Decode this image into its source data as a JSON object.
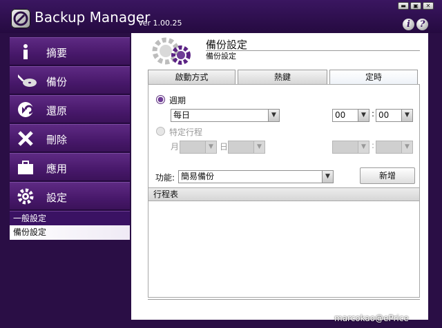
{
  "app": {
    "title": "Backup Manager",
    "version": "Ver 1.00.25",
    "window_buttons": {
      "minimize": "▬",
      "maximize": "▣",
      "close": "✕"
    },
    "info_icon_glyph": "i",
    "help_icon_glyph": "?"
  },
  "sidebar": {
    "items": [
      {
        "label": "摘要",
        "icon": "info-icon"
      },
      {
        "label": "備份",
        "icon": "backup-disc-icon"
      },
      {
        "label": "還原",
        "icon": "restore-icon"
      },
      {
        "label": "刪除",
        "icon": "delete-x-icon"
      },
      {
        "label": "應用",
        "icon": "briefcase-icon"
      },
      {
        "label": "設定",
        "icon": "gear-icon"
      }
    ],
    "sub_items": [
      {
        "label": "一般設定"
      },
      {
        "label": "備份設定",
        "selected": true
      }
    ]
  },
  "main": {
    "title": "備份設定",
    "subtitle": "備份設定",
    "tabs": [
      {
        "label": "啟動方式"
      },
      {
        "label": "熱鍵"
      },
      {
        "label": "定時",
        "active": true
      }
    ],
    "schedule": {
      "weekly_label": "週期",
      "weekly_selected": true,
      "frequency_value": "每日",
      "hour_value": "00",
      "minute_value": "00",
      "time_separator": ":",
      "specific_label": "特定行程",
      "specific_selected": false,
      "month_label": "月",
      "day_label": "日",
      "function_label": "功能:",
      "function_value": "簡易備份",
      "add_button": "新增",
      "list_header": "行程表"
    }
  },
  "watermark": "marcokao@ePrice",
  "colors": {
    "brand_purple": "#47186a",
    "background": "#2a0e45",
    "selected_radio": "#6f3d96"
  }
}
